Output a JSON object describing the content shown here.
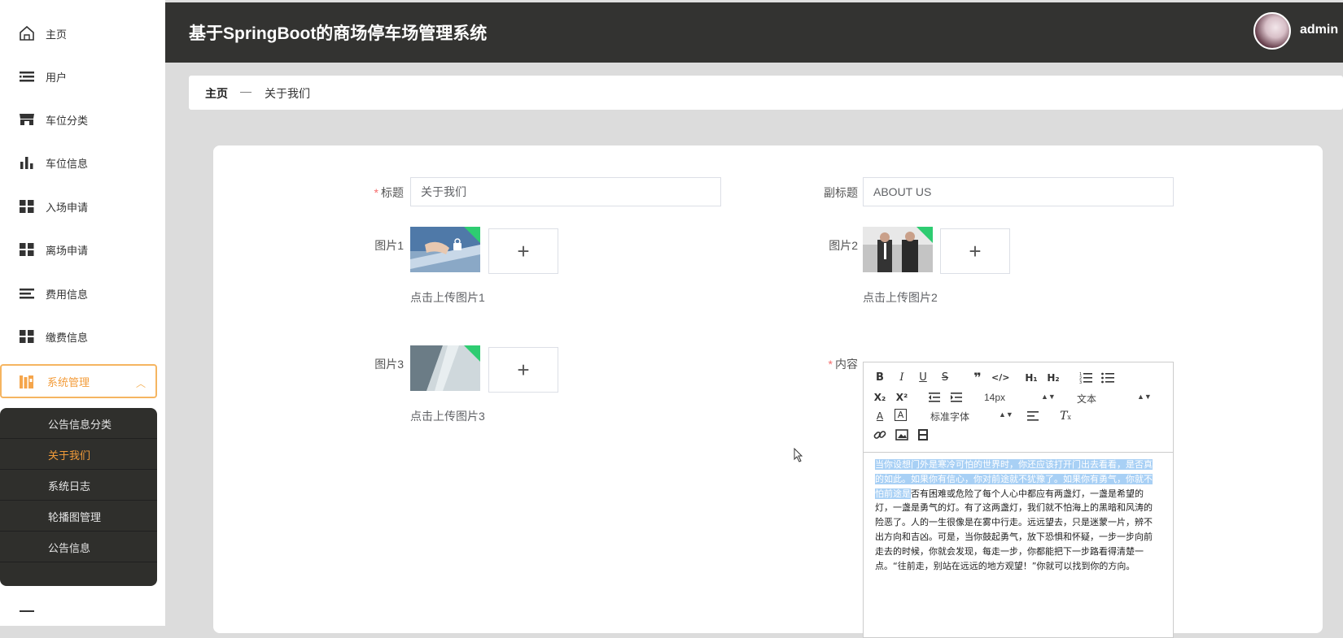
{
  "sidebar": {
    "items": [
      {
        "label": "主页",
        "icon": "home-icon"
      },
      {
        "label": "用户",
        "icon": "list-icon"
      },
      {
        "label": "车位分类",
        "icon": "store-icon"
      },
      {
        "label": "车位信息",
        "icon": "bar-chart-icon"
      },
      {
        "label": "入场申请",
        "icon": "grid-icon"
      },
      {
        "label": "离场申请",
        "icon": "grid-icon"
      },
      {
        "label": "费用信息",
        "icon": "list-icon"
      },
      {
        "label": "缴费信息",
        "icon": "grid-icon"
      },
      {
        "label": "系统管理",
        "icon": "book-icon",
        "expanded": true
      }
    ],
    "submenu": [
      {
        "label": "公告信息分类"
      },
      {
        "label": "关于我们",
        "active": true
      },
      {
        "label": "系统日志"
      },
      {
        "label": "轮播图管理"
      },
      {
        "label": "公告信息"
      }
    ]
  },
  "header": {
    "title": "基于SpringBoot的商场停车场管理系统",
    "username": "admin"
  },
  "breadcrumb": {
    "home": "主页",
    "separator": "—",
    "current": "关于我们"
  },
  "form": {
    "title_label": "标题",
    "title_value": "关于我们",
    "subtitle_label": "副标题",
    "subtitle_value": "ABOUT US",
    "image1_label": "图片1",
    "image1_hint": "点击上传图片1",
    "image2_label": "图片2",
    "image2_hint": "点击上传图片2",
    "image3_label": "图片3",
    "image3_hint": "点击上传图片3",
    "content_label": "内容",
    "required_mark": "*",
    "upload_plus": "+"
  },
  "editor": {
    "font_size": "14px",
    "text_type": "文本",
    "font_family": "标准字体",
    "content_selected": "当你设想门外是寒冷可怕的世界时，你还应该打开门出去看看，是否真的如此。如果你有信心，你对前途就不犹豫了。如果你有勇气，你就不怕前途是",
    "content_rest": "否有困难或危险了每个人心中都应有两盏灯，一盏是希望的灯，一盏是勇气的灯。有了这两盏灯，我们就不怕海上的黑暗和风涛的险恶了。人的一生很像是在雾中行走。远远望去，只是迷蒙一片，辨不出方向和吉凶。可是，当你鼓起勇气，放下恐惧和怀疑，一步一步向前走去的时候，你就会发现，每走一步，你都能把下一步路看得清楚一点。“往前走，别站在远远的地方观望！”你就可以找到你的方向。"
  },
  "colors": {
    "accent": "#f39c3a",
    "header_bg": "#333331",
    "submenu_bg": "#2f2f2c",
    "required": "#f56c6c",
    "selection": "#a8d0f5"
  }
}
